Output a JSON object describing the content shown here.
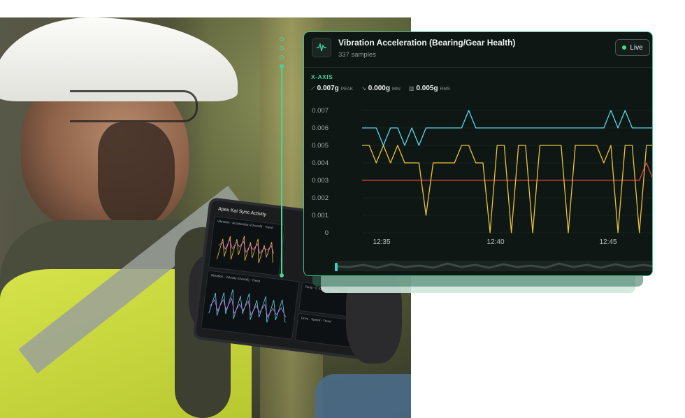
{
  "panel": {
    "title": "Vibration Acceleration (Bearing/Gear Health)",
    "subtitle": "337 samples",
    "icon": "waveform-icon",
    "live_label": "Live",
    "axis_label": "X-AXIS",
    "stats": [
      {
        "icon": "trend-icon",
        "value": "0.007g",
        "label": "PEAK"
      },
      {
        "icon": "min-trend-icon",
        "value": "0.000g",
        "label": "MIN"
      },
      {
        "icon": "bar-chart-icon",
        "value": "0.005g",
        "label": "RMS"
      }
    ]
  },
  "tablet": {
    "title": "Apex Kai Sync Activity",
    "panels": [
      "Vibration - Acceleration (Overall) - Trend",
      "Vibration - Velocity (Overall) - Trend",
      "Temp - C (Case) - Trend",
      "Drive - Speed - Trend"
    ]
  },
  "chart_data": {
    "type": "line",
    "ylim": [
      0,
      0.007
    ],
    "yticks": [
      "0.007",
      "0.006",
      "0.005",
      "0.004",
      "0.003",
      "0.002",
      "0.001",
      "0"
    ],
    "xticks": [
      "12:35",
      "12:40",
      "12:45"
    ],
    "colors": {
      "cyan": "#5bd6e8",
      "yellow": "#e9c23a",
      "red": "#e0433a"
    },
    "series": [
      {
        "color": "#5bd6e8",
        "values": [
          0.006,
          0.006,
          0.006,
          0.005,
          0.006,
          0.006,
          0.005,
          0.006,
          0.005,
          0.006,
          0.006,
          0.006,
          0.006,
          0.006,
          0.006,
          0.007,
          0.006,
          0.006,
          0.006,
          0.006,
          0.006,
          0.006,
          0.006,
          0.006,
          0.006,
          0.006,
          0.006,
          0.006,
          0.006,
          0.006,
          0.006,
          0.006,
          0.006,
          0.006,
          0.006,
          0.007,
          0.006,
          0.007,
          0.006,
          0.006,
          0.006,
          0.006
        ]
      },
      {
        "color": "#e9c23a",
        "values": [
          0.005,
          0.005,
          0.004,
          0.005,
          0.004,
          0.005,
          0.004,
          0.004,
          0.004,
          0.001,
          0.004,
          0.004,
          0.004,
          0.004,
          0.005,
          0.005,
          0.004,
          0.004,
          0.0,
          0.005,
          0.005,
          0.0,
          0.005,
          0.005,
          0.0,
          0.005,
          0.005,
          0.005,
          0.005,
          0.0,
          0.005,
          0.005,
          0.005,
          0.005,
          0.004,
          0.005,
          0.0,
          0.005,
          0.005,
          0.0,
          0.005,
          0.005
        ]
      },
      {
        "color": "#e0433a",
        "values": [
          0.003,
          0.003,
          0.003,
          0.003,
          0.003,
          0.003,
          0.003,
          0.003,
          0.003,
          0.003,
          0.003,
          0.003,
          0.003,
          0.003,
          0.003,
          0.003,
          0.003,
          0.003,
          0.003,
          0.003,
          0.003,
          0.003,
          0.003,
          0.003,
          0.003,
          0.003,
          0.003,
          0.003,
          0.003,
          0.003,
          0.003,
          0.003,
          0.003,
          0.003,
          0.003,
          0.003,
          0.003,
          0.003,
          0.003,
          0.003,
          0.004,
          0.003
        ]
      }
    ]
  }
}
